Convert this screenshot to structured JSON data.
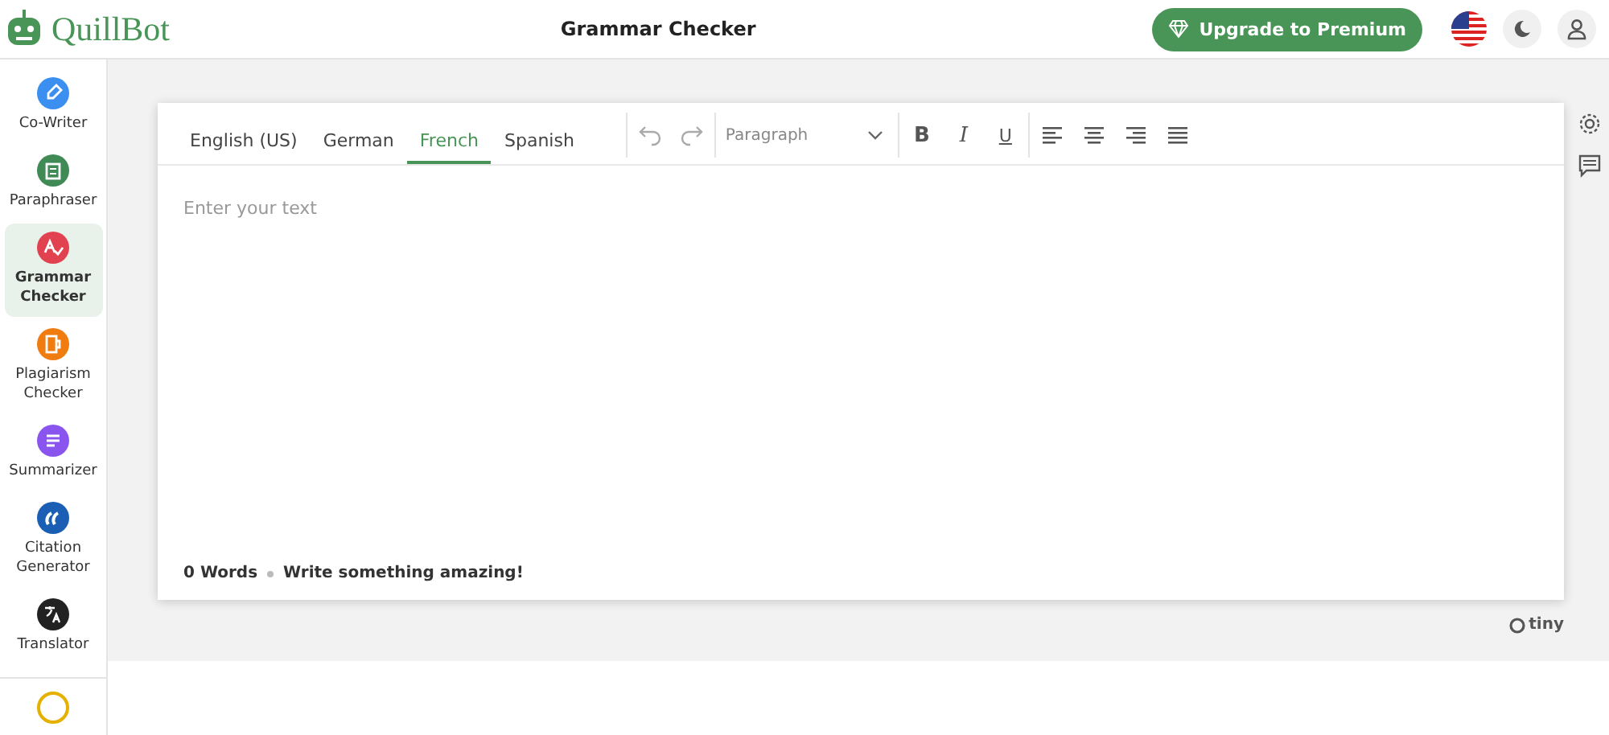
{
  "brand": {
    "name": "QuillBot"
  },
  "header": {
    "title": "Grammar Checker",
    "upgrade_button": "Upgrade to Premium"
  },
  "sidebar": {
    "items": [
      {
        "label": "Co-Writer",
        "color": "#3b8ff0",
        "selected": false,
        "kind": "pen"
      },
      {
        "label": "Paraphraser",
        "color": "#3f8a55",
        "selected": false,
        "kind": "doc"
      },
      {
        "label": "Grammar Checker",
        "color": "#e2424f",
        "selected": true,
        "kind": "grammar"
      },
      {
        "label": "Plagiarism Checker",
        "color": "#f07c10",
        "selected": false,
        "kind": "copy"
      },
      {
        "label": "Summarizer",
        "color": "#8a55ee",
        "selected": false,
        "kind": "lines"
      },
      {
        "label": "Citation Generator",
        "color": "#1a5fb4",
        "selected": false,
        "kind": "quote"
      },
      {
        "label": "Translator",
        "color": "#222222",
        "selected": false,
        "kind": "translate"
      }
    ]
  },
  "editor": {
    "tabs": [
      {
        "label": "English (US)",
        "selected": false
      },
      {
        "label": "German",
        "selected": false
      },
      {
        "label": "French",
        "selected": true
      },
      {
        "label": "Spanish",
        "selected": false
      }
    ],
    "block_format": "Paragraph",
    "format_buttons": [
      "B",
      "I",
      "U"
    ],
    "placeholder": "Enter your text",
    "word_count": "0 Words",
    "status": "Write something amazing!"
  },
  "powered_by": "tiny"
}
